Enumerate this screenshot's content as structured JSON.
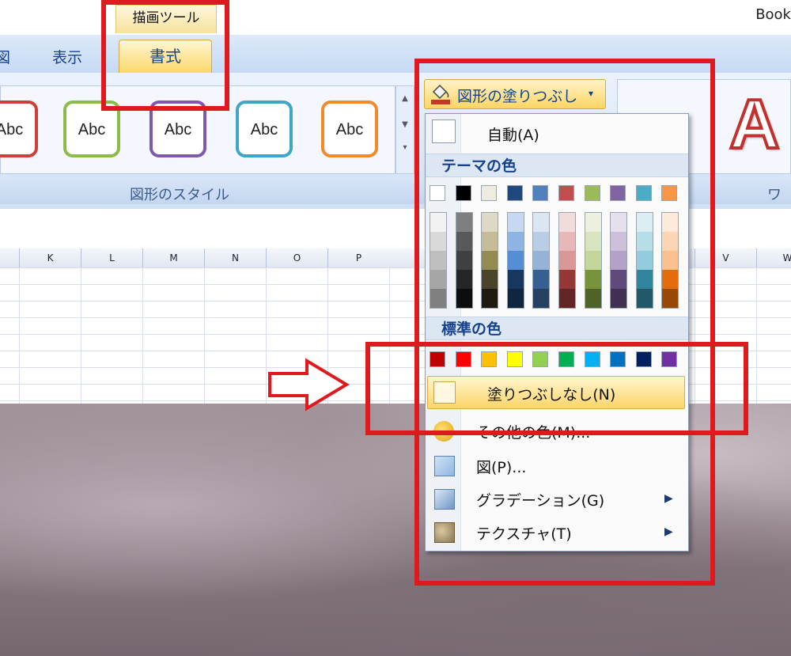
{
  "app_title": "Book",
  "context_group": "描画ツール",
  "tabs": {
    "left_partial": "図",
    "view": "表示",
    "format": "書式"
  },
  "style_gallery": {
    "swatches": [
      {
        "label": "Abc",
        "color": "#c9413a"
      },
      {
        "label": "Abc",
        "color": "#8dbb4a"
      },
      {
        "label": "Abc",
        "color": "#7f5aa8"
      },
      {
        "label": "Abc",
        "color": "#3fa6c8"
      },
      {
        "label": "Abc",
        "color": "#f08a2c"
      }
    ],
    "group_label": "図形のスタイル"
  },
  "fill_button": {
    "label": "図形の塗りつぶし",
    "arrow": "▾"
  },
  "wordart": {
    "preview": "A",
    "group_label_partial": "ワ"
  },
  "columns": [
    "K",
    "L",
    "M",
    "N",
    "O",
    "P",
    "V",
    "W"
  ],
  "dropdown": {
    "auto": "自動(A)",
    "theme_header": "テーマの色",
    "theme_colors": [
      "#ffffff",
      "#000000",
      "#eeece1",
      "#1f497d",
      "#4f81bd",
      "#c0504d",
      "#9bbb59",
      "#8064a2",
      "#4bacc6",
      "#f79646"
    ],
    "theme_shades": [
      [
        "#f2f2f2",
        "#d9d9d9",
        "#bfbfbf",
        "#a6a6a6",
        "#808080"
      ],
      [
        "#7f7f7f",
        "#595959",
        "#404040",
        "#262626",
        "#0d0d0d"
      ],
      [
        "#ddd9c4",
        "#c4bd97",
        "#948b54",
        "#4a452a",
        "#1e1c11"
      ],
      [
        "#c6d9f1",
        "#8eb4e3",
        "#558ed5",
        "#17375e",
        "#10253f"
      ],
      [
        "#dce6f2",
        "#b9cde5",
        "#95b3d7",
        "#376092",
        "#254061"
      ],
      [
        "#f2dcdb",
        "#e6b9b8",
        "#d99795",
        "#953735",
        "#632523"
      ],
      [
        "#ebf1de",
        "#d7e4bd",
        "#c3d69b",
        "#77933c",
        "#4f6228"
      ],
      [
        "#e6e0ec",
        "#ccc1da",
        "#b3a2c7",
        "#604a7b",
        "#403152"
      ],
      [
        "#dbeef4",
        "#b7dee8",
        "#93cddd",
        "#31859c",
        "#215968"
      ],
      [
        "#fdeada",
        "#fcd5b5",
        "#fac090",
        "#e46c0a",
        "#984807"
      ]
    ],
    "standard_header": "標準の色",
    "standard_colors": [
      "#c00000",
      "#ff0000",
      "#ffc000",
      "#ffff00",
      "#92d050",
      "#00b050",
      "#00b0f0",
      "#0070c0",
      "#002060",
      "#7030a0"
    ],
    "no_fill": "塗りつぶしなし(N)",
    "more_colors": "その他の色(M)...",
    "picture": "図(P)...",
    "gradient": "グラデーション(G)",
    "texture": "テクスチャ(T)",
    "submenu_arrow": "▶"
  },
  "annotation": {
    "highlight_color": "#e0191f"
  }
}
